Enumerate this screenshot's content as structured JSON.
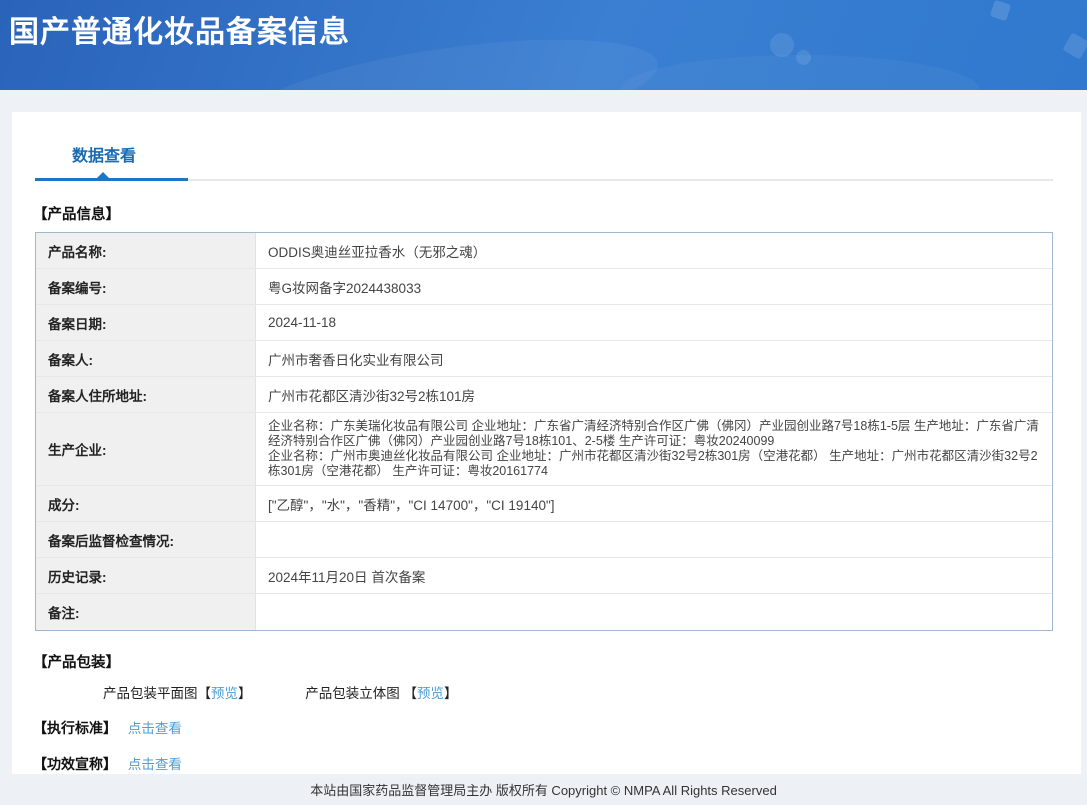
{
  "header": {
    "title": "国产普通化妆品备案信息"
  },
  "tab": {
    "label": "数据查看"
  },
  "product_info": {
    "section_title": "【产品信息】",
    "rows": [
      {
        "label": "产品名称:",
        "value": "ODDIS奥迪丝亚拉香水（无邪之魂）"
      },
      {
        "label": "备案编号:",
        "value": "粤G妆网备字2024438033"
      },
      {
        "label": "备案日期:",
        "value": "2024-11-18"
      },
      {
        "label": "备案人:",
        "value": "广州市奢香日化实业有限公司"
      },
      {
        "label": "备案人住所地址:",
        "value": "广州市花都区清沙街32号2栋101房"
      },
      {
        "label": "生产企业:",
        "value": "企业名称：广东美瑞化妆品有限公司 企业地址：广东省广清经济特别合作区广佛（佛冈）产业园创业路7号18栋1-5层 生产地址：广东省广清经济特别合作区广佛（佛冈）产业园创业路7号18栋101、2-5楼 生产许可证：粤妆20240099",
        "value2": "企业名称：广州市奥迪丝化妆品有限公司 企业地址：广州市花都区清沙街32号2栋301房（空港花都） 生产地址：广州市花都区清沙街32号2栋301房（空港花都） 生产许可证：粤妆20161774"
      },
      {
        "label": "成分:",
        "value": "[\"乙醇\"，\"水\"，\"香精\"，\"CI 14700\"，\"CI 19140\"]"
      },
      {
        "label": "备案后监督检查情况:",
        "value": ""
      },
      {
        "label": "历史记录:",
        "value": "2024年11月20日 首次备案"
      },
      {
        "label": "备注:",
        "value": ""
      }
    ]
  },
  "packaging": {
    "section_title": "【产品包装】",
    "flat_label": "产品包装平面图",
    "stereo_label": "产品包装立体图 ",
    "bracket_open": "【",
    "bracket_close": "】",
    "preview_label": "预览"
  },
  "standard": {
    "section_title": "【执行标准】",
    "link_label": "点击查看"
  },
  "efficacy": {
    "section_title": "【功效宣称】",
    "link_label": "点击查看"
  },
  "footer": {
    "text": "本站由国家药品监督管理局主办 版权所有 Copyright © NMPA All Rights Reserved"
  },
  "colors": {
    "header_gradient_start": "#2a63ba",
    "header_gradient_end": "#3a7fd2",
    "tab_blue": "#1a6bb1",
    "tab_underline": "#1d74c8",
    "link_blue": "#4d9fd6",
    "table_outer_border": "#9fb8d0",
    "label_cell_bg": "#f0f0f0",
    "page_bg": "#eef2f6",
    "footer_bg": "#edf1f5"
  }
}
